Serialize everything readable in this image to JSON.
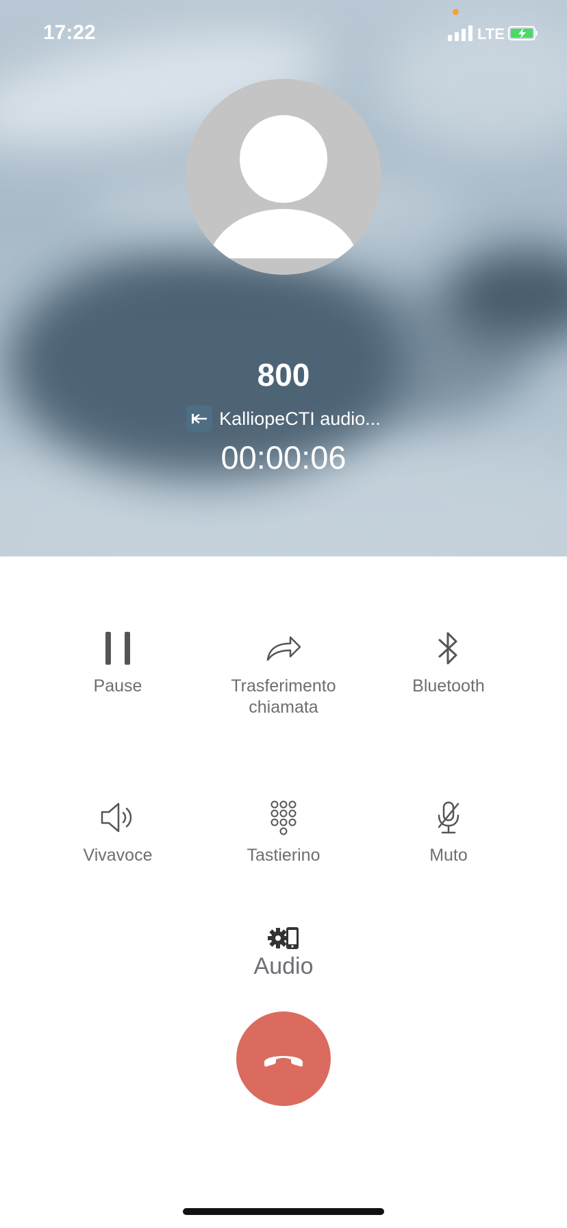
{
  "status_bar": {
    "time": "17:22",
    "network": "LTE",
    "signal_bars": 4,
    "battery_charging": true
  },
  "call": {
    "caller": "800",
    "source_app": "KalliopeCTI audio...",
    "duration": "00:00:06"
  },
  "controls": [
    {
      "label": "Pause",
      "icon": "pause-icon"
    },
    {
      "label": "Trasferimento chiamata",
      "icon": "transfer-arrow-icon"
    },
    {
      "label": "Bluetooth",
      "icon": "bluetooth-icon"
    },
    {
      "label": "Vivavoce",
      "icon": "speaker-icon"
    },
    {
      "label": "Tastierino",
      "icon": "keypad-icon"
    },
    {
      "label": "Muto",
      "icon": "mic-off-icon"
    }
  ],
  "audio": {
    "label": "Audio",
    "icon": "audio-settings-icon"
  },
  "hangup": {
    "icon": "phone-hangup-icon",
    "color": "#db6b5f"
  },
  "colors": {
    "label": "#6e6e73",
    "icon": "#555555"
  }
}
